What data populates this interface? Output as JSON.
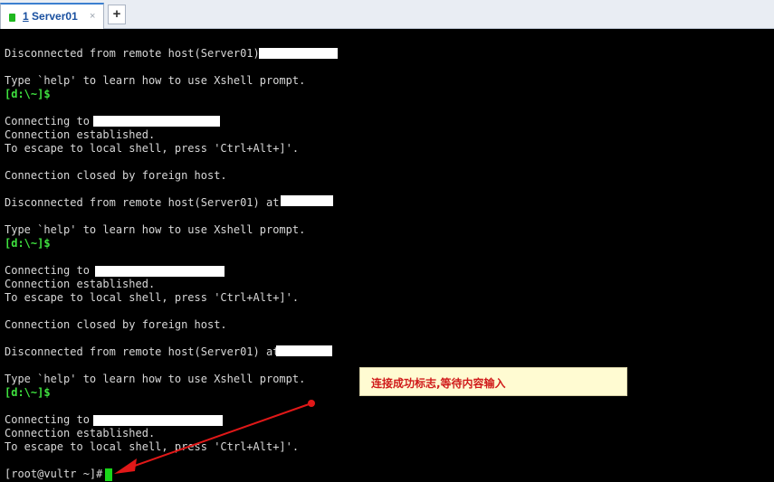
{
  "tabs": [
    {
      "number": "1",
      "label": "Server01",
      "close_symbol": "×"
    }
  ],
  "new_tab_label": "+",
  "terminal": {
    "lines": [
      {
        "text": "Disconnected from remote host(Server01) ",
        "type": "normal"
      },
      {
        "text": "Type `help' to learn how to use Xshell prompt.",
        "type": "normal"
      },
      {
        "text": "[d:\\~]$",
        "type": "prompt"
      },
      {
        "text": "Connecting to ",
        "type": "normal"
      },
      {
        "text": "Connection established.",
        "type": "normal"
      },
      {
        "text": "To escape to local shell, press 'Ctrl+Alt+]'.",
        "type": "normal"
      },
      {
        "text": "Connection closed by foreign host.",
        "type": "normal"
      },
      {
        "text": "Disconnected from remote host(Server01) at ",
        "type": "normal"
      },
      {
        "text": "Type `help' to learn how to use Xshell prompt.",
        "type": "normal"
      },
      {
        "text": "[d:\\~]$",
        "type": "prompt"
      },
      {
        "text": "Connecting to ",
        "type": "normal"
      },
      {
        "text": "Connection established.",
        "type": "normal"
      },
      {
        "text": "To escape to local shell, press 'Ctrl+Alt+]'.",
        "type": "normal"
      },
      {
        "text": "Connection closed by foreign host.",
        "type": "normal"
      },
      {
        "text": "Disconnected from remote host(Server01) at",
        "type": "normal"
      },
      {
        "text": "Type `help' to learn how to use Xshell prompt.",
        "type": "normal"
      },
      {
        "text": "[d:\\~]$",
        "type": "prompt"
      },
      {
        "text": "Connecting to ",
        "type": "normal"
      },
      {
        "text": "Connection established.",
        "type": "normal"
      },
      {
        "text": "To escape to local shell, press 'Ctrl+Alt+]'.",
        "type": "normal"
      },
      {
        "text": "[root@vultr ~]# ",
        "type": "normal"
      }
    ]
  },
  "annotation": {
    "text": "连接成功标志,等待内容输入"
  },
  "colors": {
    "terminal_background": "#000000",
    "terminal_text": "#d8d8d8",
    "prompt_text": "#3fe23f",
    "cursor": "#19d619",
    "annotation_background": "#fffbd2",
    "annotation_text": "#d01a1a",
    "arrow": "#e01818",
    "tab_text": "#1a50a0"
  }
}
